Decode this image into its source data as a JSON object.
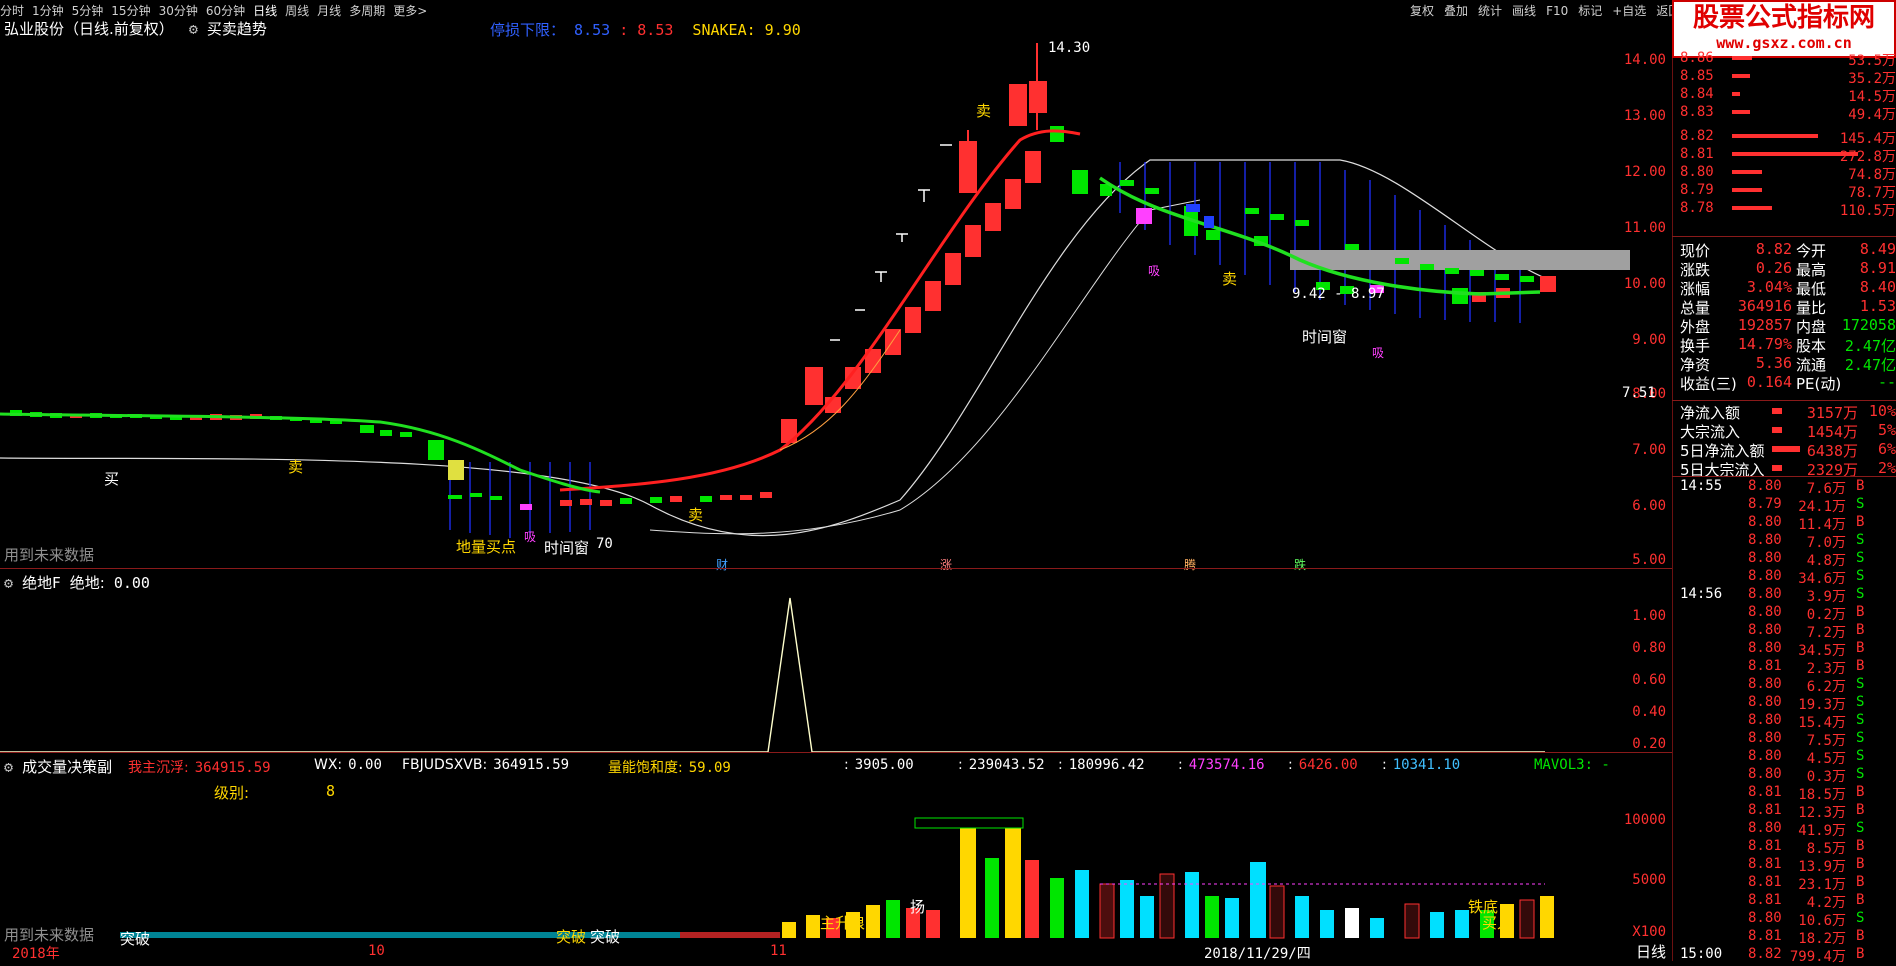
{
  "topbar": {
    "periods": [
      "分时",
      "1分钟",
      "5分钟",
      "15分钟",
      "30分钟",
      "60分钟",
      "日线",
      "周线",
      "月线",
      "多周期",
      "更多>"
    ],
    "active": "日线",
    "right_tools": [
      "复权",
      "叠加",
      "统计",
      "画线",
      "F10",
      "标记",
      "+自选",
      "返回"
    ]
  },
  "main_title": {
    "stock": "弘业股份（日线.前复权）",
    "indicator": "买卖趋势",
    "limit_down_label": "停损下限：",
    "limit_down_v1": "8.53",
    "limit_down_v2": "8.53",
    "snakea_label": "SNAKEA:",
    "snakea_value": "9.90"
  },
  "price_axis": [
    "14.00",
    "13.00",
    "12.00",
    "11.00",
    "10.00",
    "9.00",
    "8.00",
    "7.00",
    "6.00",
    "5.00"
  ],
  "price_annotations": {
    "high": "14.30",
    "low_box": "9.42 - 8.97",
    "low": "7.51",
    "base": "70"
  },
  "main_signals": {
    "buy": "买",
    "sell": "卖",
    "sell2": "卖",
    "sell3": "卖",
    "sell4": "卖",
    "ground_buy": "地量买点",
    "time_window1": "时间窗",
    "time_window2": "时间窗",
    "absorb1": "吸",
    "absorb2": "吸",
    "absorb3": "吸"
  },
  "main_event_tags": [
    "财",
    "涨",
    "腾",
    "跌"
  ],
  "future_note_1": "用到未来数据",
  "future_note_2": "用到未来数据",
  "panel2": {
    "name": "绝地F",
    "label": "绝地:",
    "value": "0.00",
    "axis": [
      "1.00",
      "0.80",
      "0.60",
      "0.40",
      "0.20"
    ]
  },
  "panel3": {
    "name": "成交量决策副",
    "fields": [
      {
        "label": "我主沉浮:",
        "value": "364915.59",
        "color": "#ff3030"
      },
      {
        "label": "WX:",
        "value": "0.00",
        "color": "#ffffff"
      },
      {
        "label": "FBJUDSXVB:",
        "value": "364915.59",
        "color": "#ffffff"
      },
      {
        "label": "量能饱和度:",
        "value": "59.09",
        "color": "#ffd700"
      },
      {
        "label": ":",
        "value": "3905.00",
        "color": "#ffffff"
      },
      {
        "label": ":",
        "value": "239043.52",
        "color": "#ffffff"
      },
      {
        "label": ":",
        "value": "180996.42",
        "color": "#ffffff"
      },
      {
        "label": ":",
        "value": "473574.16",
        "color": "#ff40ff"
      },
      {
        "label": ":",
        "value": "6426.00",
        "color": "#ff3030"
      },
      {
        "label": ":",
        "value": "10341.10",
        "color": "#40c0ff"
      }
    ],
    "mavol": "MAVOL3: -",
    "level_label": "级别:",
    "level_value": "8",
    "axis": [
      "10000",
      "5000",
      "X100"
    ],
    "signals": [
      "主升浪",
      "扬",
      "铁底",
      "突破",
      "突破",
      "突破",
      "买入"
    ]
  },
  "x_axis": {
    "labels": [
      "2018年",
      "10",
      "11",
      "2018/11/29/四"
    ],
    "period": "日线"
  },
  "order_book": [
    {
      "price": "8.86",
      "vol": "53.5万"
    },
    {
      "price": "8.85",
      "vol": "35.2万"
    },
    {
      "price": "8.84",
      "vol": "14.5万"
    },
    {
      "price": "8.83",
      "vol": "49.4万"
    },
    {
      "price": "8.82",
      "vol": "145.4万"
    },
    {
      "price": "8.81",
      "vol": "272.8万"
    },
    {
      "price": "8.80",
      "vol": "74.8万"
    },
    {
      "price": "8.79",
      "vol": "78.7万"
    },
    {
      "price": "8.78",
      "vol": "110.5万"
    }
  ],
  "quote": [
    {
      "l1": "现价",
      "v1": "8.82",
      "l2": "今开",
      "v2": "8.49"
    },
    {
      "l1": "涨跌",
      "v1": "0.26",
      "l2": "最高",
      "v2": "8.91"
    },
    {
      "l1": "涨幅",
      "v1": "3.04%",
      "l2": "最低",
      "v2": "8.40"
    },
    {
      "l1": "总量",
      "v1": "364916",
      "l2": "量比",
      "v2": "1.53"
    },
    {
      "l1": "外盘",
      "v1": "192857",
      "l2": "内盘",
      "v2": "172058"
    },
    {
      "l1": "换手",
      "v1": "14.79%",
      "l2": "股本",
      "v2": "2.47亿"
    },
    {
      "l1": "净资",
      "v1": "5.36",
      "l2": "流通",
      "v2": "2.47亿"
    },
    {
      "l1": "收益(三)",
      "v1": "0.164",
      "l2": "PE(动)",
      "v2": "--"
    }
  ],
  "flows": [
    {
      "label": "净流入额",
      "value": "3157万",
      "pct": "10%"
    },
    {
      "label": "大宗流入",
      "value": "1454万",
      "pct": "5%"
    },
    {
      "label": "5日净流入额",
      "value": "6438万",
      "pct": "6%"
    },
    {
      "label": "5日大宗流入",
      "value": "2329万",
      "pct": "2%"
    }
  ],
  "ticks": [
    {
      "time": "14:55",
      "price": "8.80",
      "vol": "7.6万",
      "side": "B"
    },
    {
      "time": "",
      "price": "8.79",
      "vol": "24.1万",
      "side": "S"
    },
    {
      "time": "",
      "price": "8.80",
      "vol": "11.4万",
      "side": "B"
    },
    {
      "time": "",
      "price": "8.80",
      "vol": "7.0万",
      "side": "S"
    },
    {
      "time": "",
      "price": "8.80",
      "vol": "4.8万",
      "side": "S"
    },
    {
      "time": "",
      "price": "8.80",
      "vol": "34.6万",
      "side": "S"
    },
    {
      "time": "14:56",
      "price": "8.80",
      "vol": "3.9万",
      "side": "S"
    },
    {
      "time": "",
      "price": "8.80",
      "vol": "0.2万",
      "side": "B"
    },
    {
      "time": "",
      "price": "8.80",
      "vol": "7.2万",
      "side": "B"
    },
    {
      "time": "",
      "price": "8.80",
      "vol": "34.5万",
      "side": "B"
    },
    {
      "time": "",
      "price": "8.81",
      "vol": "2.3万",
      "side": "B"
    },
    {
      "time": "",
      "price": "8.80",
      "vol": "6.2万",
      "side": "S"
    },
    {
      "time": "",
      "price": "8.80",
      "vol": "19.3万",
      "side": "S"
    },
    {
      "time": "",
      "price": "8.80",
      "vol": "15.4万",
      "side": "S"
    },
    {
      "time": "",
      "price": "8.80",
      "vol": "7.5万",
      "side": "S"
    },
    {
      "time": "",
      "price": "8.80",
      "vol": "4.5万",
      "side": "S"
    },
    {
      "time": "",
      "price": "8.80",
      "vol": "0.3万",
      "side": "S"
    },
    {
      "time": "",
      "price": "8.81",
      "vol": "18.5万",
      "side": "B"
    },
    {
      "time": "",
      "price": "8.81",
      "vol": "12.3万",
      "side": "B"
    },
    {
      "time": "",
      "price": "8.80",
      "vol": "41.9万",
      "side": "S"
    },
    {
      "time": "",
      "price": "8.81",
      "vol": "8.5万",
      "side": "B"
    },
    {
      "time": "",
      "price": "8.81",
      "vol": "13.9万",
      "side": "B"
    },
    {
      "time": "",
      "price": "8.81",
      "vol": "23.1万",
      "side": "B"
    },
    {
      "time": "",
      "price": "8.81",
      "vol": "4.2万",
      "side": "B"
    },
    {
      "time": "",
      "price": "8.80",
      "vol": "10.6万",
      "side": "S"
    },
    {
      "time": "",
      "price": "8.81",
      "vol": "18.2万",
      "side": "B"
    },
    {
      "time": "15:00",
      "price": "8.82",
      "vol": "799.4万",
      "side": "B"
    }
  ],
  "logo": {
    "title": "股票公式指标网",
    "url": "www.gsxz.com.cn"
  },
  "colors": {
    "up": "#ff3030",
    "down": "#00e600",
    "bg": "#000000",
    "grid": "#8a1a1a"
  }
}
